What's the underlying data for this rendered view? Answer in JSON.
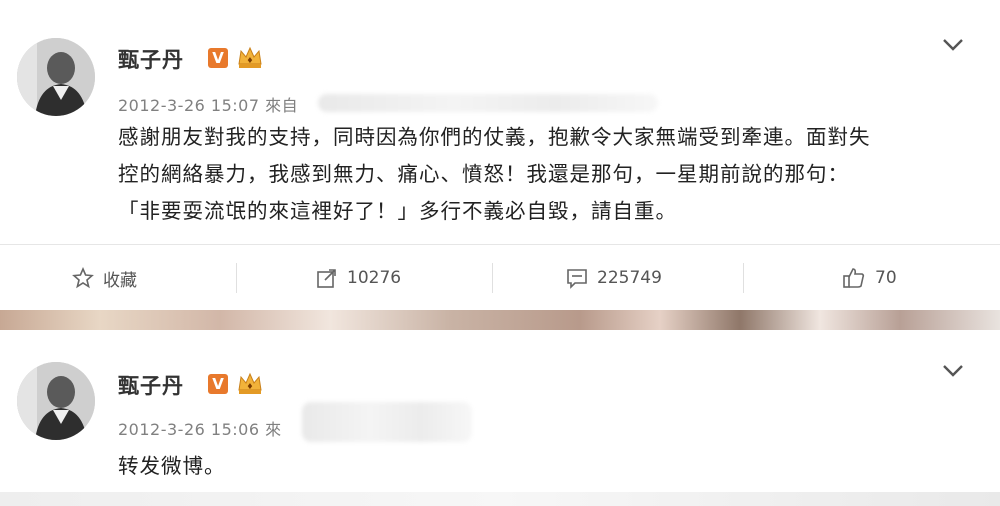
{
  "posts": [
    {
      "author": "甄子丹",
      "verified_badge": "V",
      "crown_icon": "crown-icon",
      "timestamp": "2012-3-26 15:07",
      "source_prefix": "來自",
      "content_lines": [
        "感謝朋友對我的支持，同時因為你們的仗義，抱歉令大家無端受到牽連。面對失",
        "控的網絡暴力，我感到無力、痛心、憤怒！我還是那句，一星期前說的那句：",
        "「非要耍流氓的來這裡好了！」多行不義必自毀，請自重。"
      ],
      "actions": {
        "favorite_label": "收藏",
        "repost_count": "10276",
        "comment_count": "225749",
        "like_count": "70"
      }
    },
    {
      "author": "甄子丹",
      "verified_badge": "V",
      "crown_icon": "crown-icon",
      "timestamp": "2012-3-26 15:06",
      "source_prefix": "來",
      "content_lines": [
        "转发微博。"
      ]
    }
  ],
  "colors": {
    "verified": "#e8792c",
    "meta": "#808080",
    "text": "#222222"
  }
}
